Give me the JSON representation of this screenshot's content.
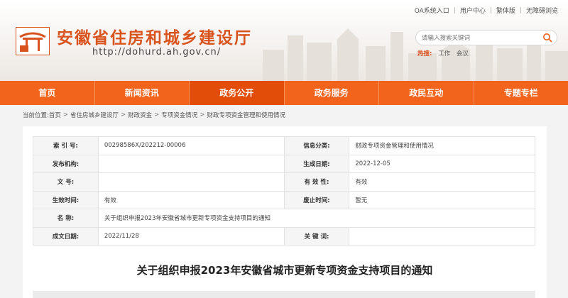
{
  "header": {
    "top_links": [
      "OA系统入口",
      "用户中心",
      "繁体版",
      "无障碍浏览"
    ],
    "site_title": "安徽省住房和城乡建设厅",
    "site_url": "http://dohurd.ah.gov.cn/",
    "search_placeholder": "请输入搜索关键词",
    "hot_label": "热搜:",
    "hot_items": [
      "工作",
      "会议"
    ]
  },
  "nav": [
    "首页",
    "新闻资讯",
    "政务公开",
    "政务服务",
    "政民互动",
    "专题专栏"
  ],
  "nav_active": "政务公开",
  "breadcrumb": {
    "prefix": "当前位置:",
    "items": [
      "首页",
      "省住房城乡建设厅",
      "财政资金",
      "专项资金情况",
      "财政专项资金管理和使用情况"
    ]
  },
  "meta": [
    [
      "索 引 号:",
      "00298586X/202212-00006",
      "信息分类:",
      "财政专项资金管理和使用情况"
    ],
    [
      "发布机构:",
      "",
      "生成日期:",
      "2022-12-05"
    ],
    [
      "文 号:",
      "",
      "有 效 性:",
      "有效"
    ],
    [
      "生效时间:",
      "有效",
      "废止时间:",
      "暂无"
    ],
    [
      "名 称:",
      "关于组织申报2023年安徽省城市更新专项资金支持项目的通知"
    ],
    [
      "成文日期:",
      "2022/11/28",
      "关 键 词:",
      ""
    ]
  ],
  "doc_title": "关于组织申报2023年安徽省城市更新专项资金支持项目的通知",
  "colors": {
    "accent": "#f2631b",
    "title": "#d9531e"
  }
}
